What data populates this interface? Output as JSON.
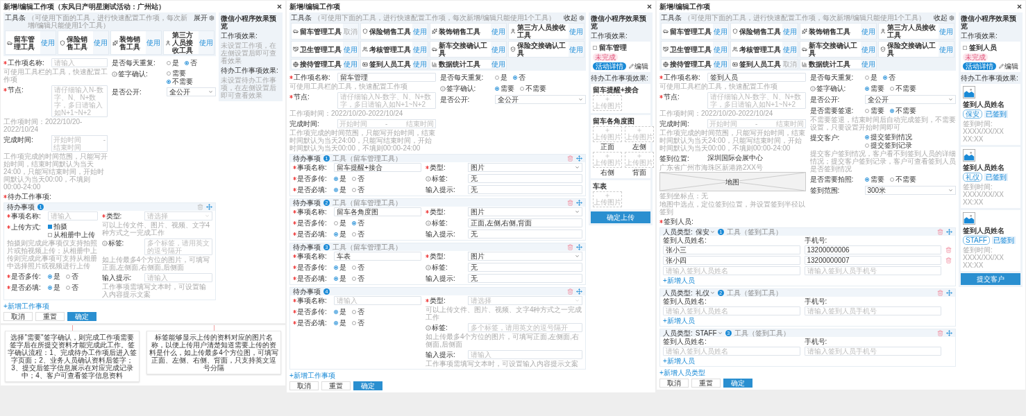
{
  "panels": [
    {
      "title": "新增/编辑工作项（东风日产明星测试活动：广州站）",
      "toolbox": {
        "title": "工具条",
        "hint": "（可使用下面的工具，进行快速配置工作项，每次新增/编辑只能使用1个工具）",
        "toggle": "展开",
        "tools": [
          {
            "label": "留车管理工具",
            "action": "使用",
            "disabled": false
          },
          {
            "label": "保险销售工具",
            "action": "使用",
            "disabled": false
          },
          {
            "label": "装饰销售工具",
            "action": "使用",
            "disabled": false
          },
          {
            "label": "第三方人员接收工具",
            "action": "使用",
            "disabled": false
          }
        ]
      },
      "form": {
        "left": [
          {
            "kind": "input",
            "label": "工作项名称:",
            "required": true,
            "info": false,
            "placeholder": "请输入",
            "hint": "可使用工具栏的工具，快速配置工作项"
          },
          {
            "kind": "input",
            "label": "节点:",
            "required": true,
            "info": false,
            "placeholder": "请仔细输入N-数字、N、N+数字，多日请输入如N+1~N+2",
            "hint": "工作项时间：2022/10/20-2022/10/24"
          },
          {
            "kind": "range",
            "label": "完成时间:",
            "required": false,
            "info": false,
            "start": "开始时间",
            "separator": "-",
            "end": "结束时间",
            "hint": "工作项完成的时间范围，只能写开始时间，结束时间默认为当天24:00，只能写结束时间，开始时间默认为当天00:00，不填则00:00-24:00"
          }
        ],
        "right": [
          {
            "kind": "radio",
            "label": "是否每天重复:",
            "required": false,
            "info": false,
            "options": [
              {
                "label": "是",
                "selected": false
              },
              {
                "label": "否",
                "selected": true
              }
            ]
          },
          {
            "kind": "radio",
            "label": "签字确认:",
            "required": false,
            "info": true,
            "options": [
              {
                "label": "需要",
                "selected": false
              },
              {
                "label": "不需要",
                "selected": true
              }
            ]
          },
          {
            "kind": "select",
            "label": "是否公开:",
            "required": false,
            "info": false,
            "value": "全公开"
          }
        ]
      },
      "sections": [
        {
          "label": "待办工作事项:",
          "required": true,
          "cards": [
            {
              "kind": "todo",
              "title": "待办事项",
              "badge": "1",
              "deletable": false,
              "left": [
                {
                  "kind": "input",
                  "label": "事项名称:",
                  "required": true,
                  "info": false,
                  "placeholder": "请输入"
                },
                {
                  "kind": "checks",
                  "label": "上传方式:",
                  "required": true,
                  "info": false,
                  "options": [
                    {
                      "label": "拍摄",
                      "checked": true
                    },
                    {
                      "label": "从相册中上传",
                      "checked": false
                    }
                  ],
                  "hint": "拍摄则完成此事项仅支持拍照片或拍视频上传；从相册中上传则完成此事项可支持从相册中选择照片或视频进行上传"
                },
                {
                  "kind": "radio",
                  "label": "是否多传:",
                  "required": true,
                  "info": false,
                  "options": [
                    {
                      "label": "是",
                      "selected": true
                    },
                    {
                      "label": "否",
                      "selected": false
                    }
                  ]
                },
                {
                  "kind": "radio",
                  "label": "是否必填:",
                  "required": true,
                  "info": false,
                  "options": [
                    {
                      "label": "是",
                      "selected": true
                    },
                    {
                      "label": "否",
                      "selected": false
                    }
                  ]
                }
              ],
              "right": [
                {
                  "kind": "select",
                  "label": "类型:",
                  "required": true,
                  "info": false,
                  "placeholder": "请选择",
                  "hint": "可以上传文件、图片、视频、文字4种方式之一完成工作"
                },
                {
                  "kind": "input",
                  "label": "标签:",
                  "required": false,
                  "info": true,
                  "placeholder": "多个标签，请用英文的逗号隔开",
                  "hint": "如上传最多4个方位的图片，可填写正面,左侧面,右侧面,后侧面"
                },
                {
                  "kind": "input",
                  "label": "输入提示:",
                  "required": false,
                  "info": false,
                  "placeholder": "请输入",
                  "hint": "工作事项需填写文本时，可设置输入内容提示文案"
                }
              ]
            }
          ],
          "add_link": "+新增工作事项"
        }
      ],
      "buttons": [
        {
          "label": "取消",
          "primary": false
        },
        {
          "label": "重置",
          "primary": false
        },
        {
          "label": "确定",
          "primary": true
        }
      ],
      "preview": {
        "title": "微信小程序效果预览",
        "sections": [
          {
            "kind": "empty",
            "label": "工作项效果:",
            "text": "未设置工作项，在左侧设置后即可查看效果"
          },
          {
            "kind": "empty",
            "label": "待办工作事项效果:",
            "text": "未设置待办工作事项，在左侧设置后即可查看效果"
          }
        ]
      }
    },
    {
      "title": "新增/编辑工作项",
      "toolbox": {
        "title": "工具条",
        "hint": "（可使用下面的工具，进行快速配置工作项，每次新增/编辑只能使用1个工具）",
        "toggle": "收起",
        "tools": [
          {
            "label": "留车管理工具",
            "action": "取消",
            "disabled": true
          },
          {
            "label": "保险销售工具",
            "action": "使用",
            "disabled": false
          },
          {
            "label": "装饰销售工具",
            "action": "使用",
            "disabled": false
          },
          {
            "label": "第三方人员接收工具",
            "action": "使用",
            "disabled": false
          },
          {
            "label": "卫生管理工具",
            "action": "使用",
            "disabled": false
          },
          {
            "label": "考核管理工具",
            "action": "使用",
            "disabled": false
          },
          {
            "label": "新车交接确认工具",
            "action": "使用",
            "disabled": false
          },
          {
            "label": "保险交接确认工具",
            "action": "使用",
            "disabled": false
          },
          {
            "label": "接待管理工具",
            "action": "使用",
            "disabled": false
          },
          {
            "label": "签到人员工具",
            "action": "使用",
            "disabled": false
          },
          {
            "label": "数据统计工具",
            "action": "使用",
            "disabled": false
          }
        ]
      },
      "form": {
        "left": [
          {
            "kind": "input",
            "label": "工作项名称:",
            "required": true,
            "info": false,
            "value": "留车管理",
            "hint": "可使用工具栏的工具，快速配置工作项"
          },
          {
            "kind": "input",
            "label": "节点:",
            "required": true,
            "info": false,
            "placeholder": "请仔细输入N-数字、N、N+数字，多日请输入如N+1~N+2",
            "hint": "工作项时间：2022/10/20-2022/10/24"
          },
          {
            "kind": "range",
            "label": "完成时间:",
            "required": false,
            "info": false,
            "start": "开始时间",
            "separator": "-",
            "end": "结束时间",
            "hint": "工作项完成的时间范围，只能写开始时间，结束时间默认为当天24:00，只能写结束时间，开始时间默认为当天00:00，不填则00:00-24:00"
          }
        ],
        "right": [
          {
            "kind": "radio",
            "label": "是否每天重复:",
            "required": false,
            "info": false,
            "options": [
              {
                "label": "是",
                "selected": false
              },
              {
                "label": "否",
                "selected": true
              }
            ]
          },
          {
            "kind": "radio",
            "label": "签字确认:",
            "required": false,
            "info": true,
            "options": [
              {
                "label": "需要",
                "selected": true
              },
              {
                "label": "不需要",
                "selected": false
              }
            ]
          },
          {
            "kind": "select",
            "label": "是否公开:",
            "required": false,
            "info": false,
            "value": "全公开"
          }
        ]
      },
      "sections": [
        {
          "cards": [
            {
              "kind": "todo",
              "title": "待办事项",
              "badge": "1",
              "tool": "工具（留车管理工具）",
              "deletable": true,
              "left": [
                {
                  "kind": "input",
                  "label": "事项名称:",
                  "required": true,
                  "info": false,
                  "value": "留车提醒+接合"
                },
                {
                  "kind": "radio",
                  "label": "是否多传:",
                  "required": true,
                  "info": false,
                  "options": [
                    {
                      "label": "是",
                      "selected": true
                    },
                    {
                      "label": "否",
                      "selected": false
                    }
                  ]
                },
                {
                  "kind": "radio",
                  "label": "是否必填:",
                  "required": true,
                  "info": false,
                  "options": [
                    {
                      "label": "是",
                      "selected": true
                    },
                    {
                      "label": "否",
                      "selected": false
                    }
                  ]
                }
              ],
              "right": [
                {
                  "kind": "select",
                  "label": "类型:",
                  "required": true,
                  "info": false,
                  "value": "图片"
                },
                {
                  "kind": "input",
                  "label": "标签:",
                  "required": false,
                  "info": true,
                  "value": "无"
                },
                {
                  "kind": "input",
                  "label": "输入提示:",
                  "required": false,
                  "info": false,
                  "value": "无"
                }
              ]
            },
            {
              "kind": "todo",
              "title": "待办事项",
              "badge": "2",
              "tool": "工具（留车管理工具）",
              "deletable": true,
              "left": [
                {
                  "kind": "input",
                  "label": "事项名称:",
                  "required": true,
                  "info": false,
                  "value": "留车各角度图"
                },
                {
                  "kind": "radio",
                  "label": "是否多传:",
                  "required": true,
                  "info": false,
                  "options": [
                    {
                      "label": "是",
                      "selected": false
                    },
                    {
                      "label": "否",
                      "selected": true
                    }
                  ]
                },
                {
                  "kind": "radio",
                  "label": "是否必填:",
                  "required": true,
                  "info": false,
                  "options": [
                    {
                      "label": "是",
                      "selected": true
                    },
                    {
                      "label": "否",
                      "selected": false
                    }
                  ]
                }
              ],
              "right": [
                {
                  "kind": "select",
                  "label": "类型:",
                  "required": true,
                  "info": false,
                  "value": "图片"
                },
                {
                  "kind": "input",
                  "label": "标签:",
                  "required": false,
                  "info": true,
                  "value": "正面,左侧,右侧,背面"
                },
                {
                  "kind": "input",
                  "label": "输入提示:",
                  "required": false,
                  "info": false,
                  "value": "无"
                }
              ]
            },
            {
              "kind": "todo",
              "title": "待办事项",
              "badge": "3",
              "tool": "工具（留车管理工具）",
              "deletable": true,
              "left": [
                {
                  "kind": "input",
                  "label": "事项名称:",
                  "required": true,
                  "info": false,
                  "value": "车表"
                },
                {
                  "kind": "radio",
                  "label": "是否多传:",
                  "required": true,
                  "info": false,
                  "options": [
                    {
                      "label": "是",
                      "selected": true
                    },
                    {
                      "label": "否",
                      "selected": false
                    }
                  ]
                },
                {
                  "kind": "radio",
                  "label": "是否必填:",
                  "required": true,
                  "info": false,
                  "options": [
                    {
                      "label": "是",
                      "selected": true
                    },
                    {
                      "label": "否",
                      "selected": false
                    }
                  ]
                }
              ],
              "right": [
                {
                  "kind": "select",
                  "label": "类型:",
                  "required": true,
                  "info": false,
                  "value": "图片"
                },
                {
                  "kind": "input",
                  "label": "标签:",
                  "required": false,
                  "info": true,
                  "value": "无"
                },
                {
                  "kind": "input",
                  "label": "输入提示:",
                  "required": false,
                  "info": false,
                  "value": "无"
                }
              ]
            },
            {
              "kind": "todo",
              "title": "待办事项",
              "badge": "4",
              "deletable": true,
              "left": [
                {
                  "kind": "input",
                  "label": "事项名称:",
                  "required": true,
                  "info": false,
                  "placeholder": "请输入"
                },
                {
                  "kind": "radio",
                  "label": "是否多传:",
                  "required": true,
                  "info": false,
                  "options": [
                    {
                      "label": "是",
                      "selected": true
                    },
                    {
                      "label": "否",
                      "selected": false
                    }
                  ]
                },
                {
                  "kind": "radio",
                  "label": "是否必填:",
                  "required": true,
                  "info": false,
                  "options": [
                    {
                      "label": "是",
                      "selected": true
                    },
                    {
                      "label": "否",
                      "selected": false
                    }
                  ]
                }
              ],
              "right": [
                {
                  "kind": "select",
                  "label": "类型:",
                  "required": true,
                  "info": false,
                  "placeholder": "请选择",
                  "hint": "可以上传文件、图片、视频、文字4种方式之一完成工作"
                },
                {
                  "kind": "input",
                  "label": "标签:",
                  "required": false,
                  "info": true,
                  "placeholder": "多个标签，请用英文的逗号隔开",
                  "hint": "如上传最多4个方位的图片，可填写正面,左侧面,右侧面,后侧面"
                },
                {
                  "kind": "input",
                  "label": "输入提示:",
                  "required": false,
                  "info": false,
                  "placeholder": "请输入",
                  "hint": "工作事项需填写文本时，可设置输入内容提示文案"
                }
              ]
            }
          ],
          "add_link": "+新增工作事项"
        }
      ],
      "buttons": [
        {
          "label": "取消",
          "primary": false
        },
        {
          "label": "重置",
          "primary": false
        },
        {
          "label": "确定",
          "primary": true
        }
      ],
      "preview": {
        "title": "微信小程序效果预览",
        "sections": [
          {
            "kind": "work",
            "label": "工作项效果:",
            "card": {
              "checked": false,
              "name": "留车管理",
              "status": "未完成",
              "action": "活动详情",
              "edit": "编辑"
            }
          },
          {
            "kind": "uploads",
            "label": "待办工作事项效果:",
            "cards": [
              {
                "title": "留车提醒+接合",
                "slots": [
                  {
                    "caption": "上传图片"
                  }
                ]
              },
              {
                "title": "留车各角度图",
                "slots": [
                  {
                    "caption": "上传图片",
                    "label": "正面"
                  },
                  {
                    "caption": "上传图片",
                    "label": "左侧"
                  },
                  {
                    "caption": "上传图片",
                    "label": "右侧"
                  },
                  {
                    "caption": "上传图片",
                    "label": "背面"
                  }
                ]
              },
              {
                "title": "车表",
                "slots": [
                  {
                    "caption": "上传图片"
                  }
                ]
              }
            ]
          }
        ],
        "button": "确定上传"
      }
    },
    {
      "title": "新增/编辑工作项",
      "toolbox": {
        "title": "工具条",
        "hint": "（可使用下面的工具，进行快速配置工作项，每次新增/编辑只能使用1个工具）",
        "toggle": "收起",
        "tools": [
          {
            "label": "留车管理工具",
            "action": "使用",
            "disabled": false
          },
          {
            "label": "保险销售工具",
            "action": "使用",
            "disabled": false
          },
          {
            "label": "装饰销售工具",
            "action": "使用",
            "disabled": false
          },
          {
            "label": "第三方人员接收工具",
            "action": "使用",
            "disabled": false
          },
          {
            "label": "卫生管理工具",
            "action": "使用",
            "disabled": false
          },
          {
            "label": "考核管理工具",
            "action": "使用",
            "disabled": false
          },
          {
            "label": "新车交接确认工具",
            "action": "使用",
            "disabled": false
          },
          {
            "label": "保险交接确认工具",
            "action": "使用",
            "disabled": false
          },
          {
            "label": "接待管理工具",
            "action": "使用",
            "disabled": false
          },
          {
            "label": "签到人员工具",
            "action": "取消",
            "disabled": true
          },
          {
            "label": "数据统计工具",
            "action": "使用",
            "disabled": false
          }
        ]
      },
      "form": {
        "left": [
          {
            "kind": "input",
            "label": "工作项名称:",
            "required": true,
            "info": false,
            "value": "签到人员",
            "hint": "可使用工具栏的工具，快速配置工作项"
          },
          {
            "kind": "input",
            "label": "节点:",
            "required": true,
            "info": false,
            "placeholder": "请仔细输入N-数字、N、N+数字，多日请输入如N+1~N+2",
            "hint": "工作项时间：2022/10/20-2022/10/24"
          },
          {
            "kind": "range",
            "label": "完成时间:",
            "required": false,
            "info": false,
            "start": "开始时间",
            "separator": "-",
            "end": "结束时间",
            "hint": "工作项完成的时间范围，只能写开始时间，结束时间默认为当天24:00，只能写结束时间，开始时间默认为当天00:00，不填则00:00-24:00"
          },
          {
            "kind": "location",
            "label": "签到位置:",
            "required": false,
            "info": false,
            "value": "深圳国际会展中心",
            "hint": "广东省广州市海珠区新港路2XX号",
            "map_label": "地图",
            "hints": [
              "签到坐标点：无",
              "地图中选点，定位签到位置，并设置签到半径以签到"
            ]
          }
        ],
        "right": [
          {
            "kind": "radio",
            "label": "是否每天重复:",
            "required": false,
            "info": false,
            "options": [
              {
                "label": "是",
                "selected": false
              },
              {
                "label": "否",
                "selected": true
              }
            ]
          },
          {
            "kind": "radio",
            "label": "签字确认:",
            "required": false,
            "info": true,
            "options": [
              {
                "label": "需要",
                "selected": true
              },
              {
                "label": "不需要",
                "selected": false
              }
            ]
          },
          {
            "kind": "select",
            "label": "是否公开:",
            "required": false,
            "info": false,
            "value": "全公开"
          },
          {
            "kind": "radio",
            "label": "是否需要签退:",
            "required": false,
            "info": false,
            "options": [
              {
                "label": "需要",
                "selected": false
              },
              {
                "label": "不需要",
                "selected": true
              }
            ],
            "hint": "不需要签退，结束时间后自动完成签到，不需要设置，只要设置开始时间即可"
          },
          {
            "kind": "radio",
            "label": "提交客户:",
            "required": false,
            "info": false,
            "options": [
              {
                "label": "提交签到情况",
                "selected": true
              },
              {
                "label": "提交签到记录",
                "selected": false
              }
            ],
            "hint": "提交客户签到情况，客户看不到签到人员的详细情况；提交客户签到记录，客户可查看签到人员是否签到情况"
          },
          {
            "kind": "radio",
            "label": "是否需要拍照:",
            "required": false,
            "info": false,
            "options": [
              {
                "label": "需要",
                "selected": true
              },
              {
                "label": "不需要",
                "selected": false
              }
            ]
          },
          {
            "kind": "select",
            "label": "签到范围:",
            "required": false,
            "info": false,
            "value": "300米"
          }
        ]
      },
      "sections": [
        {
          "label": "签到人员:",
          "required": true,
          "cards": [
            {
              "kind": "staff",
              "title": "人员类型:",
              "type_value": "保安",
              "badge": "1",
              "tool": "工具（签到工具）",
              "deletable": true,
              "name_header": "签到人员姓名:",
              "phone_header": "手机号:",
              "people": [
                {
                  "name": "张小三",
                  "phone": "13200000006",
                  "deletable": true
                },
                {
                  "name": "张小四",
                  "phone": "13200000007",
                  "deletable": true
                },
                {
                  "name_placeholder": "请输入签到人员姓名",
                  "phone_placeholder": "请输入签到人员手机号",
                  "deletable": false
                }
              ],
              "add_link": "+新增人员"
            },
            {
              "kind": "staff",
              "title": "人员类型:",
              "type_value": "礼仪",
              "badge": "2",
              "tool": "工具（签到工具）",
              "deletable": true,
              "name_header": "签到人员姓名:",
              "phone_header": "手机号:",
              "people": [
                {
                  "name_placeholder": "请输入签到人员姓名",
                  "phone_placeholder": "请输入签到人员手机号",
                  "deletable": false
                }
              ],
              "add_link": "+新增人员"
            },
            {
              "kind": "staff",
              "title": "人员类型:",
              "type_value": "STAFF",
              "badge": "3",
              "tool": "工具（签到工具）",
              "deletable": true,
              "name_header": "签到人员姓名:",
              "phone_header": "手机号:",
              "people": [
                {
                  "name_placeholder": "请输入签到人员姓名",
                  "phone_placeholder": "请输入签到人员手机号",
                  "deletable": false
                }
              ],
              "add_link": "+新增人员"
            }
          ],
          "add_link": "+新增人员类型"
        }
      ],
      "buttons": [
        {
          "label": "取消",
          "primary": false
        },
        {
          "label": "重置",
          "primary": false
        },
        {
          "label": "确定",
          "primary": true
        }
      ],
      "preview": {
        "title": "微信小程序效果预览",
        "sections": [
          {
            "kind": "work",
            "label": "工作项效果:",
            "card": {
              "checked": false,
              "name": "签到人员",
              "status": "未完成",
              "action": "活动详情",
              "edit": "编辑"
            }
          },
          {
            "kind": "checkins",
            "label": "待办工作事项效果:",
            "cards": [
              {
                "name": "签到人员姓名",
                "tag": "保安",
                "state": "已签到",
                "time": "签到时间: XXXX/XX/XX XX:XX"
              },
              {
                "name": "签到人员姓名",
                "tag": "礼仪",
                "state": "已签到",
                "time": "签到时间: XXXX/XX/XX XX:XX"
              },
              {
                "name": "签到人员姓名",
                "tag": "STAFF",
                "state": "已签到",
                "time": "签到时间: XXXX/XX/XX XX:XX"
              }
            ]
          }
        ],
        "button": "提交客户"
      }
    }
  ],
  "notes": [
    {
      "text": "选择\"需要\"签字确认，则完成工作项需要签字后在所提交资料才能完成此工作。签字确认流程：1、完成待办工作项后进入签字页面；2、业务人员确认资料后签字；3、提交后签字信息展示在对应完成记录中；4、客户可查看签字信息资料"
    },
    {
      "text": "标签能够显示上传的资料对应的图片名称，以便上传用户清楚知道需要上传的资料是什么，如上传最多4个方位图，可填写正面、左侧、右侧、背面，只支持英文逗号分隔"
    }
  ]
}
